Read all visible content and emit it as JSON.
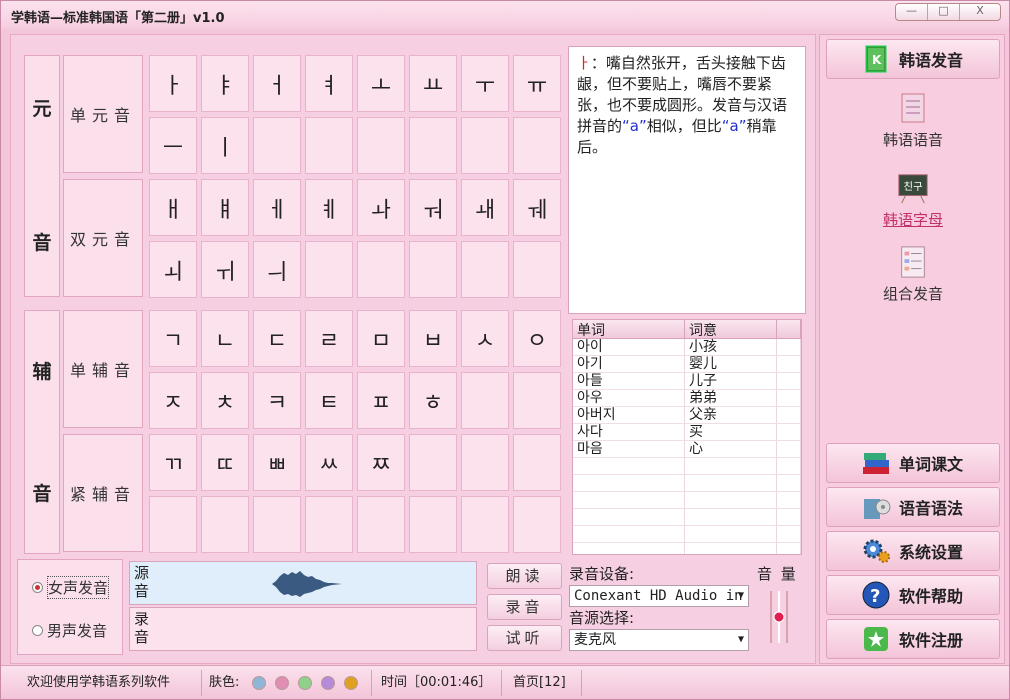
{
  "window": {
    "title": "学韩语—标准韩国语「第二册」v1.0",
    "min": "—",
    "max": "□",
    "close": "X"
  },
  "categories": {
    "yuan": "元",
    "yin1": "音",
    "fu": "辅",
    "yin2": "音"
  },
  "rows": [
    {
      "label": "单元音",
      "chars": [
        "ㅏ",
        "ㅑ",
        "ㅓ",
        "ㅕ",
        "ㅗ",
        "ㅛ",
        "ㅜ",
        "ㅠ",
        "ㅡ",
        "ㅣ",
        "",
        "",
        "",
        "",
        "",
        ""
      ]
    },
    {
      "label": "双元音",
      "chars": [
        "ㅐ",
        "ㅒ",
        "ㅔ",
        "ㅖ",
        "ㅘ",
        "ㅝ",
        "ㅙ",
        "ㅞ",
        "ㅚ",
        "ㅟ",
        "ㅢ",
        "",
        "",
        "",
        "",
        ""
      ]
    },
    {
      "label": "单辅音",
      "chars": [
        "ㄱ",
        "ㄴ",
        "ㄷ",
        "ㄹ",
        "ㅁ",
        "ㅂ",
        "ㅅ",
        "ㅇ",
        "ㅈ",
        "ㅊ",
        "ㅋ",
        "ㅌ",
        "ㅍ",
        "ㅎ",
        "",
        ""
      ]
    },
    {
      "label": "紧辅音",
      "chars": [
        "ㄲ",
        "ㄸ",
        "ㅃ",
        "ㅆ",
        "ㅉ",
        "",
        "",
        "",
        "",
        "",
        "",
        "",
        "",
        "",
        "",
        ""
      ]
    }
  ],
  "description": {
    "char": "ㅏ",
    "text1": "：嘴自然张开，舌头接触下齿龈，但不要贴上，嘴唇不要紧张，也不要成圆形。发音与汉语拼音的",
    "q1": "“a”",
    "text2": "相似，但比",
    "q2": "“a”",
    "text3": "稍靠后。"
  },
  "wordtable": {
    "headers": [
      "单词",
      "词意"
    ],
    "rows": [
      {
        "word": "아이",
        "meaning": "小孩"
      },
      {
        "word": "아기",
        "meaning": "婴儿"
      },
      {
        "word": "아들",
        "meaning": "儿子"
      },
      {
        "word": "아우",
        "meaning": "弟弟"
      },
      {
        "word": "아버지",
        "meaning": "父亲"
      },
      {
        "word": "사다",
        "meaning": "买"
      },
      {
        "word": "마음",
        "meaning": "心"
      },
      {
        "word": "",
        "meaning": ""
      },
      {
        "word": "",
        "meaning": ""
      },
      {
        "word": "",
        "meaning": ""
      },
      {
        "word": "",
        "meaning": ""
      },
      {
        "word": "",
        "meaning": ""
      },
      {
        "word": "",
        "meaning": ""
      }
    ]
  },
  "voice": {
    "female": "女声发音",
    "male": "男声发音",
    "selected": "female"
  },
  "wave": {
    "src_a": "源",
    "src_b": "音",
    "rec_a": "录",
    "rec_b": "音"
  },
  "actions": {
    "read": "朗读",
    "record": "录音",
    "listen": "试听"
  },
  "device": {
    "rec_label": "录音设备:",
    "rec_value": "Conexant HD Audio in",
    "src_label": "音源选择:",
    "src_value": "麦克风",
    "volume_label": "音 量",
    "volume_level": 0.5
  },
  "sidebar": {
    "top": "韩语发音",
    "subitems": [
      "韩语语音",
      "韩语字母",
      "组合发音"
    ],
    "active_sub": 1,
    "buttons": [
      "单词课文",
      "语音语法",
      "系统设置",
      "软件帮助",
      "软件注册"
    ]
  },
  "status": {
    "welcome": "欢迎使用学韩语系列软件",
    "skin_label": "肤色:",
    "skins": [
      "#8fb6d6",
      "#e08fb2",
      "#8fd08a",
      "#b58ad8",
      "#e0a022"
    ],
    "time": "时间［00:01:46］",
    "page": "首页[12]"
  },
  "colors": {
    "accent_pink": "#f4c6da",
    "link": "#c0306a",
    "blue_text": "#2030d0"
  }
}
